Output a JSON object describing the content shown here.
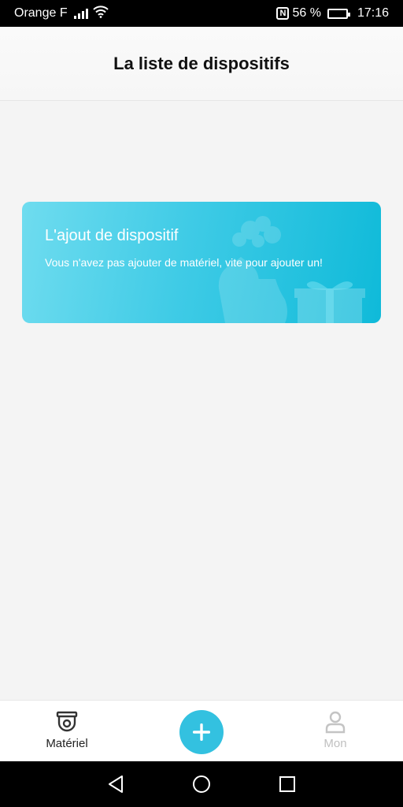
{
  "status_bar": {
    "carrier": "Orange F",
    "battery": "56 %",
    "battery_level": 0.56,
    "time": "17:16",
    "icons": [
      "signal-icon",
      "wifi-icon",
      "nfc-icon",
      "battery-icon"
    ]
  },
  "header": {
    "title": "La liste de dispositifs"
  },
  "add_card": {
    "title": "L'ajout de dispositif",
    "subtitle": "Vous n'avez pas ajouter de matériel, vite pour ajouter un!",
    "colors": {
      "gradient_start": "#6fdcef",
      "gradient_end": "#0fbad9"
    }
  },
  "bottom_nav": {
    "items": [
      {
        "label": "Matériel",
        "icon": "camera-icon",
        "active": true
      },
      {
        "label": "Mon",
        "icon": "person-icon",
        "active": false
      }
    ],
    "add_icon": "plus-icon",
    "accent": "#33c1e0"
  },
  "system_nav": {
    "icons": [
      "back-icon",
      "home-icon",
      "recent-apps-icon"
    ]
  }
}
